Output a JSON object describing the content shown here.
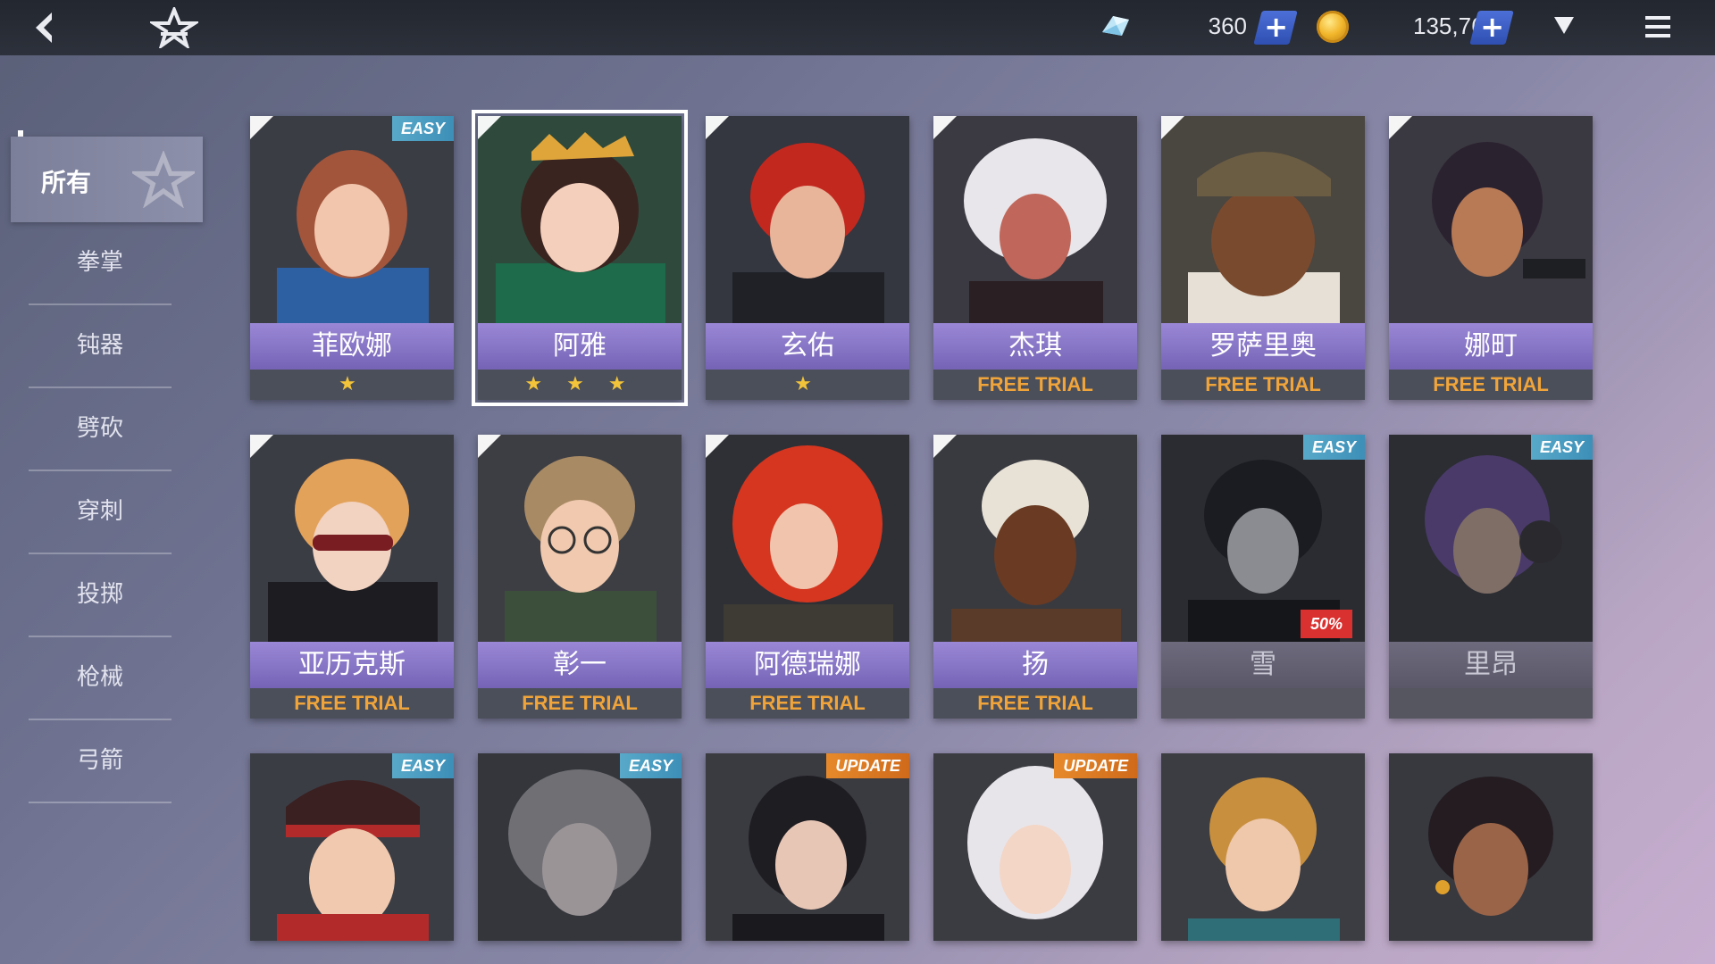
{
  "topbar": {
    "gem_amount": "360",
    "coin_amount": "135,765",
    "plus_label": "+"
  },
  "sidebar": {
    "items": [
      {
        "label": "所有",
        "active": true
      },
      {
        "label": "拳掌"
      },
      {
        "label": "钝器"
      },
      {
        "label": "劈砍"
      },
      {
        "label": "穿刺"
      },
      {
        "label": "投掷"
      },
      {
        "label": "枪械"
      },
      {
        "label": "弓箭"
      }
    ]
  },
  "characters": {
    "row1": [
      {
        "name": "菲欧娜",
        "sub": "★",
        "tag": "EASY"
      },
      {
        "name": "阿雅",
        "sub": "★ ★ ★",
        "selected": true
      },
      {
        "name": "玄佑",
        "sub": "★"
      },
      {
        "name": "杰琪",
        "sub": "FREE TRIAL"
      },
      {
        "name": "罗萨里奥",
        "sub": "FREE TRIAL"
      },
      {
        "name": "娜町",
        "sub": "FREE TRIAL"
      }
    ],
    "row2": [
      {
        "name": "亚历克斯",
        "sub": "FREE TRIAL"
      },
      {
        "name": "彰一",
        "sub": "FREE TRIAL"
      },
      {
        "name": "阿德瑞娜",
        "sub": "FREE TRIAL"
      },
      {
        "name": "扬",
        "sub": "FREE TRIAL"
      },
      {
        "name": "雪",
        "sub": "",
        "tag": "EASY",
        "discount": "50%"
      },
      {
        "name": "里昂",
        "sub": "",
        "tag": "EASY"
      }
    ],
    "row3": [
      {
        "tag": "EASY"
      },
      {
        "tag": "EASY"
      },
      {
        "tag": "UPDATE"
      },
      {
        "tag": "UPDATE"
      },
      {},
      {}
    ]
  },
  "colors": {
    "accent_purple": "#8a78cc",
    "free_trial": "#f0a43a",
    "star": "#f3c43a",
    "easy_tag": "#4a9ec3",
    "update_tag": "#de7a25",
    "discount": "#d9312f"
  },
  "icons": {
    "back": "back-arrow-icon",
    "logo": "star-emblem-icon",
    "gem": "gem-icon",
    "coin": "coin-icon",
    "dropdown": "triangle-down-icon",
    "menu": "hamburger-menu-icon"
  }
}
